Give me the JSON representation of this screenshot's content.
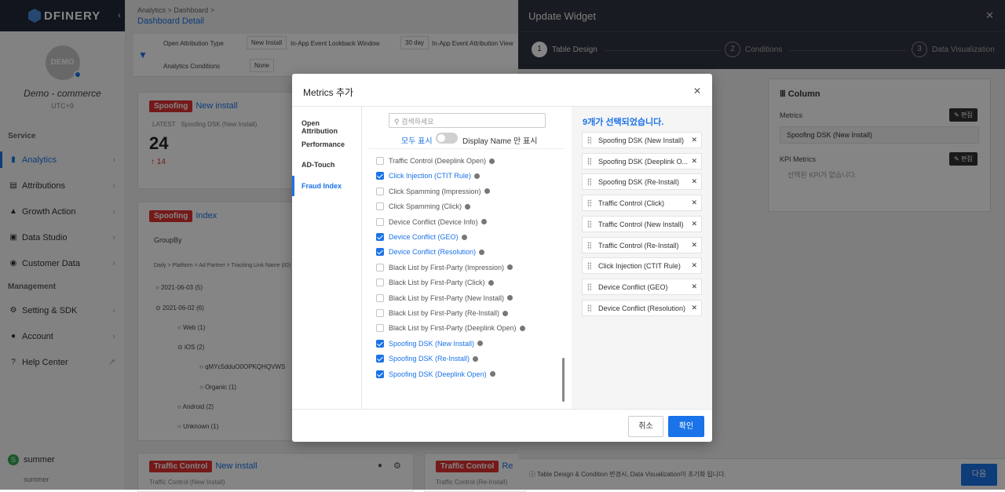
{
  "sidebar": {
    "logo": "DFINERY",
    "avatar_text": "DEMO",
    "app_name": "Demo - commerce",
    "app_meta": "UTC+9",
    "service_title": "Service",
    "service_items": [
      {
        "label": "Analytics"
      },
      {
        "label": "Attributions"
      },
      {
        "label": "Growth Action"
      },
      {
        "label": "Data Studio"
      },
      {
        "label": "Customer Data"
      }
    ],
    "management_title": "Management",
    "management_items": [
      {
        "label": "Setting & SDK"
      },
      {
        "label": "Account"
      },
      {
        "label": "Help Center"
      }
    ],
    "user_initial": "S",
    "user_name": "summer",
    "user_sub": "summer"
  },
  "main": {
    "crumb1": "Analytics",
    "crumb2": "Dashboard",
    "title": "Dashboard Detail",
    "filters": {
      "open_attr_label": "Open Attribution Type",
      "open_attr_value": "New Install",
      "lookback_label": "In-App Event Lookback Window",
      "lookback_value": "30 day",
      "inapp_label": "In-App Event Attribution View",
      "conditions_label": "Analytics Conditions",
      "conditions_value": "None"
    },
    "card1": {
      "tag": "Spoofing",
      "sub": "New install",
      "latest": "LATEST",
      "metric": "Spoofing DSK (New Install)",
      "value": "24",
      "delta": "↑ 14"
    },
    "card2": {
      "tag": "Spoofing",
      "sub": "Index",
      "groupby": "GroupBy",
      "path": "Daily > Platform > Ad Partner > Tracking Link Name (ID)",
      "rows": [
        "2021-06-03 (5)",
        "2021-06-02 (6)",
        "Web (1)",
        "iOS (2)",
        "qMYc5dduO0OPKQHQVWS",
        "Organic (1)",
        "Android (2)",
        "Unknown (1)"
      ]
    },
    "card3": {
      "tag": "Traffic Control",
      "sub": "New install",
      "metric": "Traffic Control (New Install)"
    },
    "card4": {
      "tag": "Traffic Control",
      "sub": "Re",
      "metric": "Traffic Control (Re-Install)"
    }
  },
  "panel": {
    "title": "Update Widget",
    "steps": [
      {
        "num": "1",
        "label": "Table Design"
      },
      {
        "num": "2",
        "label": "Conditions"
      },
      {
        "num": "3",
        "label": "Data Visualization"
      }
    ],
    "column_title": "Column",
    "metrics_label": "Metrics",
    "edit_label": "편집",
    "metric_value": "Spoofing DSK (New Install)",
    "kpi_label": "KPI Metrics",
    "kpi_empty": "선택된 KPI가 없습니다.",
    "foot_note": "Table Design & Condition 변경시, Data Visualization이 초기화 됩니다.",
    "next_label": "다음"
  },
  "modal": {
    "title": "Metrics 추가",
    "categories": [
      {
        "label": "Open Attribution"
      },
      {
        "label": "Performance"
      },
      {
        "label": "AD-Touch"
      },
      {
        "label": "Fraud Index"
      }
    ],
    "search_placeholder": "검색하세요",
    "toggle_left": "모두 표시",
    "toggle_right": "Display Name 만 표시",
    "items": [
      {
        "label": "Traffic Control (Deeplink Open)",
        "checked": false
      },
      {
        "label": "Click Injection (CTIT Rule)",
        "checked": true
      },
      {
        "label": "Click Spamming (Impression)",
        "checked": false
      },
      {
        "label": "Click Spamming (Click)",
        "checked": false
      },
      {
        "label": "Device Conflict (Device Info)",
        "checked": false
      },
      {
        "label": "Device Conflict (GEO)",
        "checked": true
      },
      {
        "label": "Device Conflict (Resolution)",
        "checked": true
      },
      {
        "label": "Black List by First-Party (Impression)",
        "checked": false
      },
      {
        "label": "Black List by First-Party (Click)",
        "checked": false
      },
      {
        "label": "Black List by First-Party (New Install)",
        "checked": false
      },
      {
        "label": "Black List by First-Party (Re-Install)",
        "checked": false
      },
      {
        "label": "Black List by First-Party (Deeplink Open)",
        "checked": false
      },
      {
        "label": "Spoofing DSK (New Install)",
        "checked": true
      },
      {
        "label": "Spoofing DSK (Re-Install)",
        "checked": true
      },
      {
        "label": "Spoofing DSK (Deeplink Open)",
        "checked": true
      }
    ],
    "selected_title": "9개가 선택되었습니다.",
    "selected": [
      {
        "label": "Spoofing DSK (New Install)"
      },
      {
        "label": "Spoofing DSK (Deeplink O..."
      },
      {
        "label": "Spoofing DSK (Re-Install)"
      },
      {
        "label": "Traffic Control (Click)"
      },
      {
        "label": "Traffic Control (New Install)"
      },
      {
        "label": "Traffic Control (Re-Install)"
      },
      {
        "label": "Click Injection (CTIT Rule)"
      },
      {
        "label": "Device Conflict (GEO)"
      },
      {
        "label": "Device Conflict (Resolution)"
      }
    ],
    "cancel_label": "취소",
    "ok_label": "확인"
  },
  "colors": {
    "accent": "#1a73e8",
    "tag_red": "#e03131",
    "panel_dark": "#2f3540"
  }
}
